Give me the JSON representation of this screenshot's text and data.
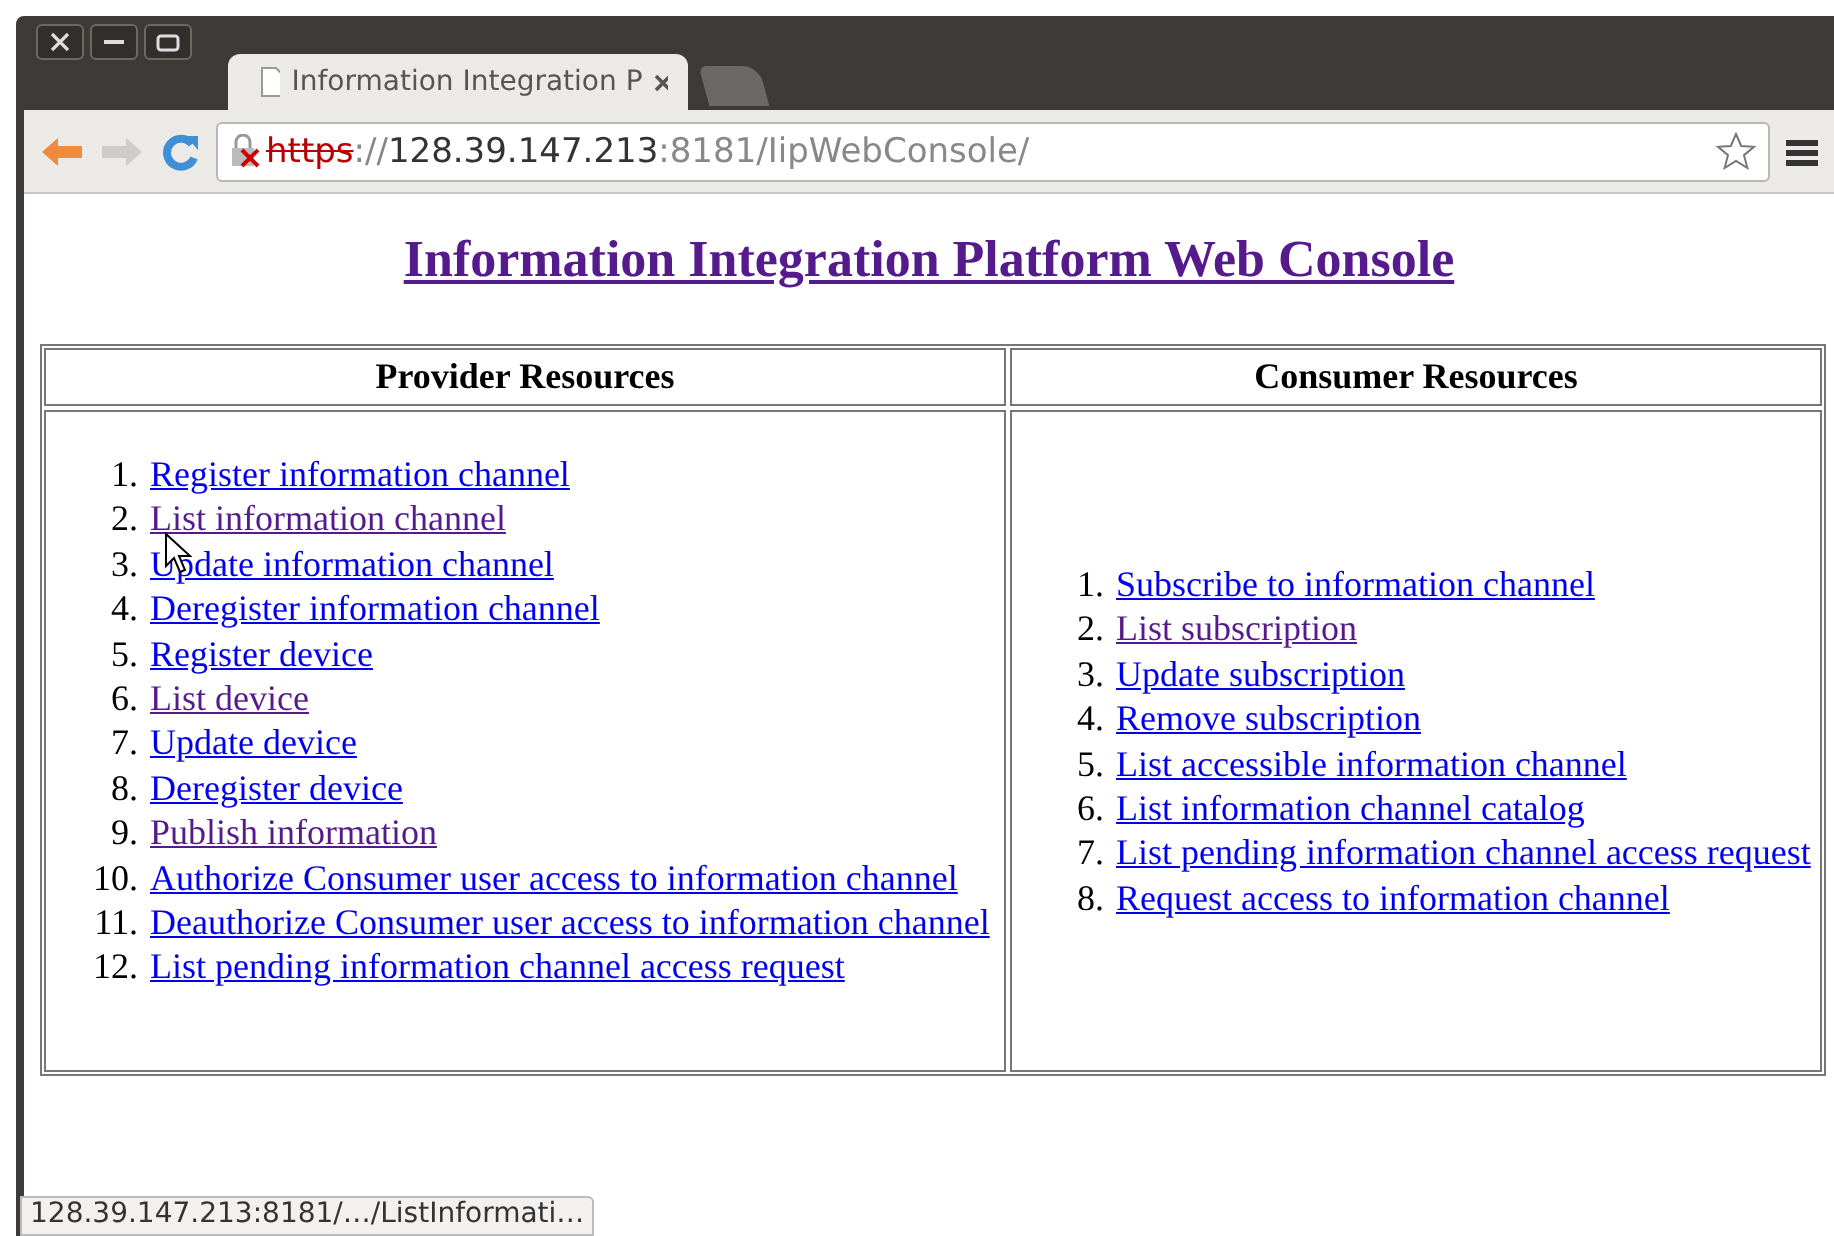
{
  "tab": {
    "title": "Information Integration P"
  },
  "address": {
    "scheme": "https",
    "separator": "://",
    "host": "128.39.147.213",
    "path": ":8181/IipWebConsole/"
  },
  "page": {
    "title": "Information Integration Platform Web Console",
    "title_visited": true,
    "columns": [
      {
        "heading": "Provider Resources",
        "items": [
          {
            "number": "1.",
            "label": "Register information channel",
            "visited": false
          },
          {
            "number": "2.",
            "label": "List information channel",
            "visited": true
          },
          {
            "number": "3.",
            "label": "Update information channel",
            "visited": false
          },
          {
            "number": "4.",
            "label": "Deregister information channel",
            "visited": false
          },
          {
            "number": "5.",
            "label": "Register device",
            "visited": false
          },
          {
            "number": "6.",
            "label": "List device",
            "visited": true
          },
          {
            "number": "7.",
            "label": "Update device",
            "visited": false
          },
          {
            "number": "8.",
            "label": "Deregister device",
            "visited": false
          },
          {
            "number": "9.",
            "label": "Publish information",
            "visited": true
          },
          {
            "number": "10.",
            "label": "Authorize Consumer user access to information channel",
            "visited": false
          },
          {
            "number": "11.",
            "label": "Deauthorize Consumer user access to information channel",
            "visited": false
          },
          {
            "number": "12.",
            "label": "List pending information channel access request",
            "visited": false
          }
        ]
      },
      {
        "heading": "Consumer Resources",
        "items": [
          {
            "number": "1.",
            "label": "Subscribe to information channel",
            "visited": false
          },
          {
            "number": "2.",
            "label": "List subscription",
            "visited": true
          },
          {
            "number": "3.",
            "label": "Update subscription",
            "visited": false
          },
          {
            "number": "4.",
            "label": "Remove subscription",
            "visited": false
          },
          {
            "number": "5.",
            "label": "List accessible information channel",
            "visited": false
          },
          {
            "number": "6.",
            "label": "List information channel catalog",
            "visited": false
          },
          {
            "number": "7.",
            "label": "List pending information channel access request",
            "visited": false
          },
          {
            "number": "8.",
            "label": "Request access to information channel",
            "visited": false
          }
        ]
      }
    ]
  },
  "status_bar": {
    "text": "128.39.147.213:8181/…/ListInformati…"
  }
}
